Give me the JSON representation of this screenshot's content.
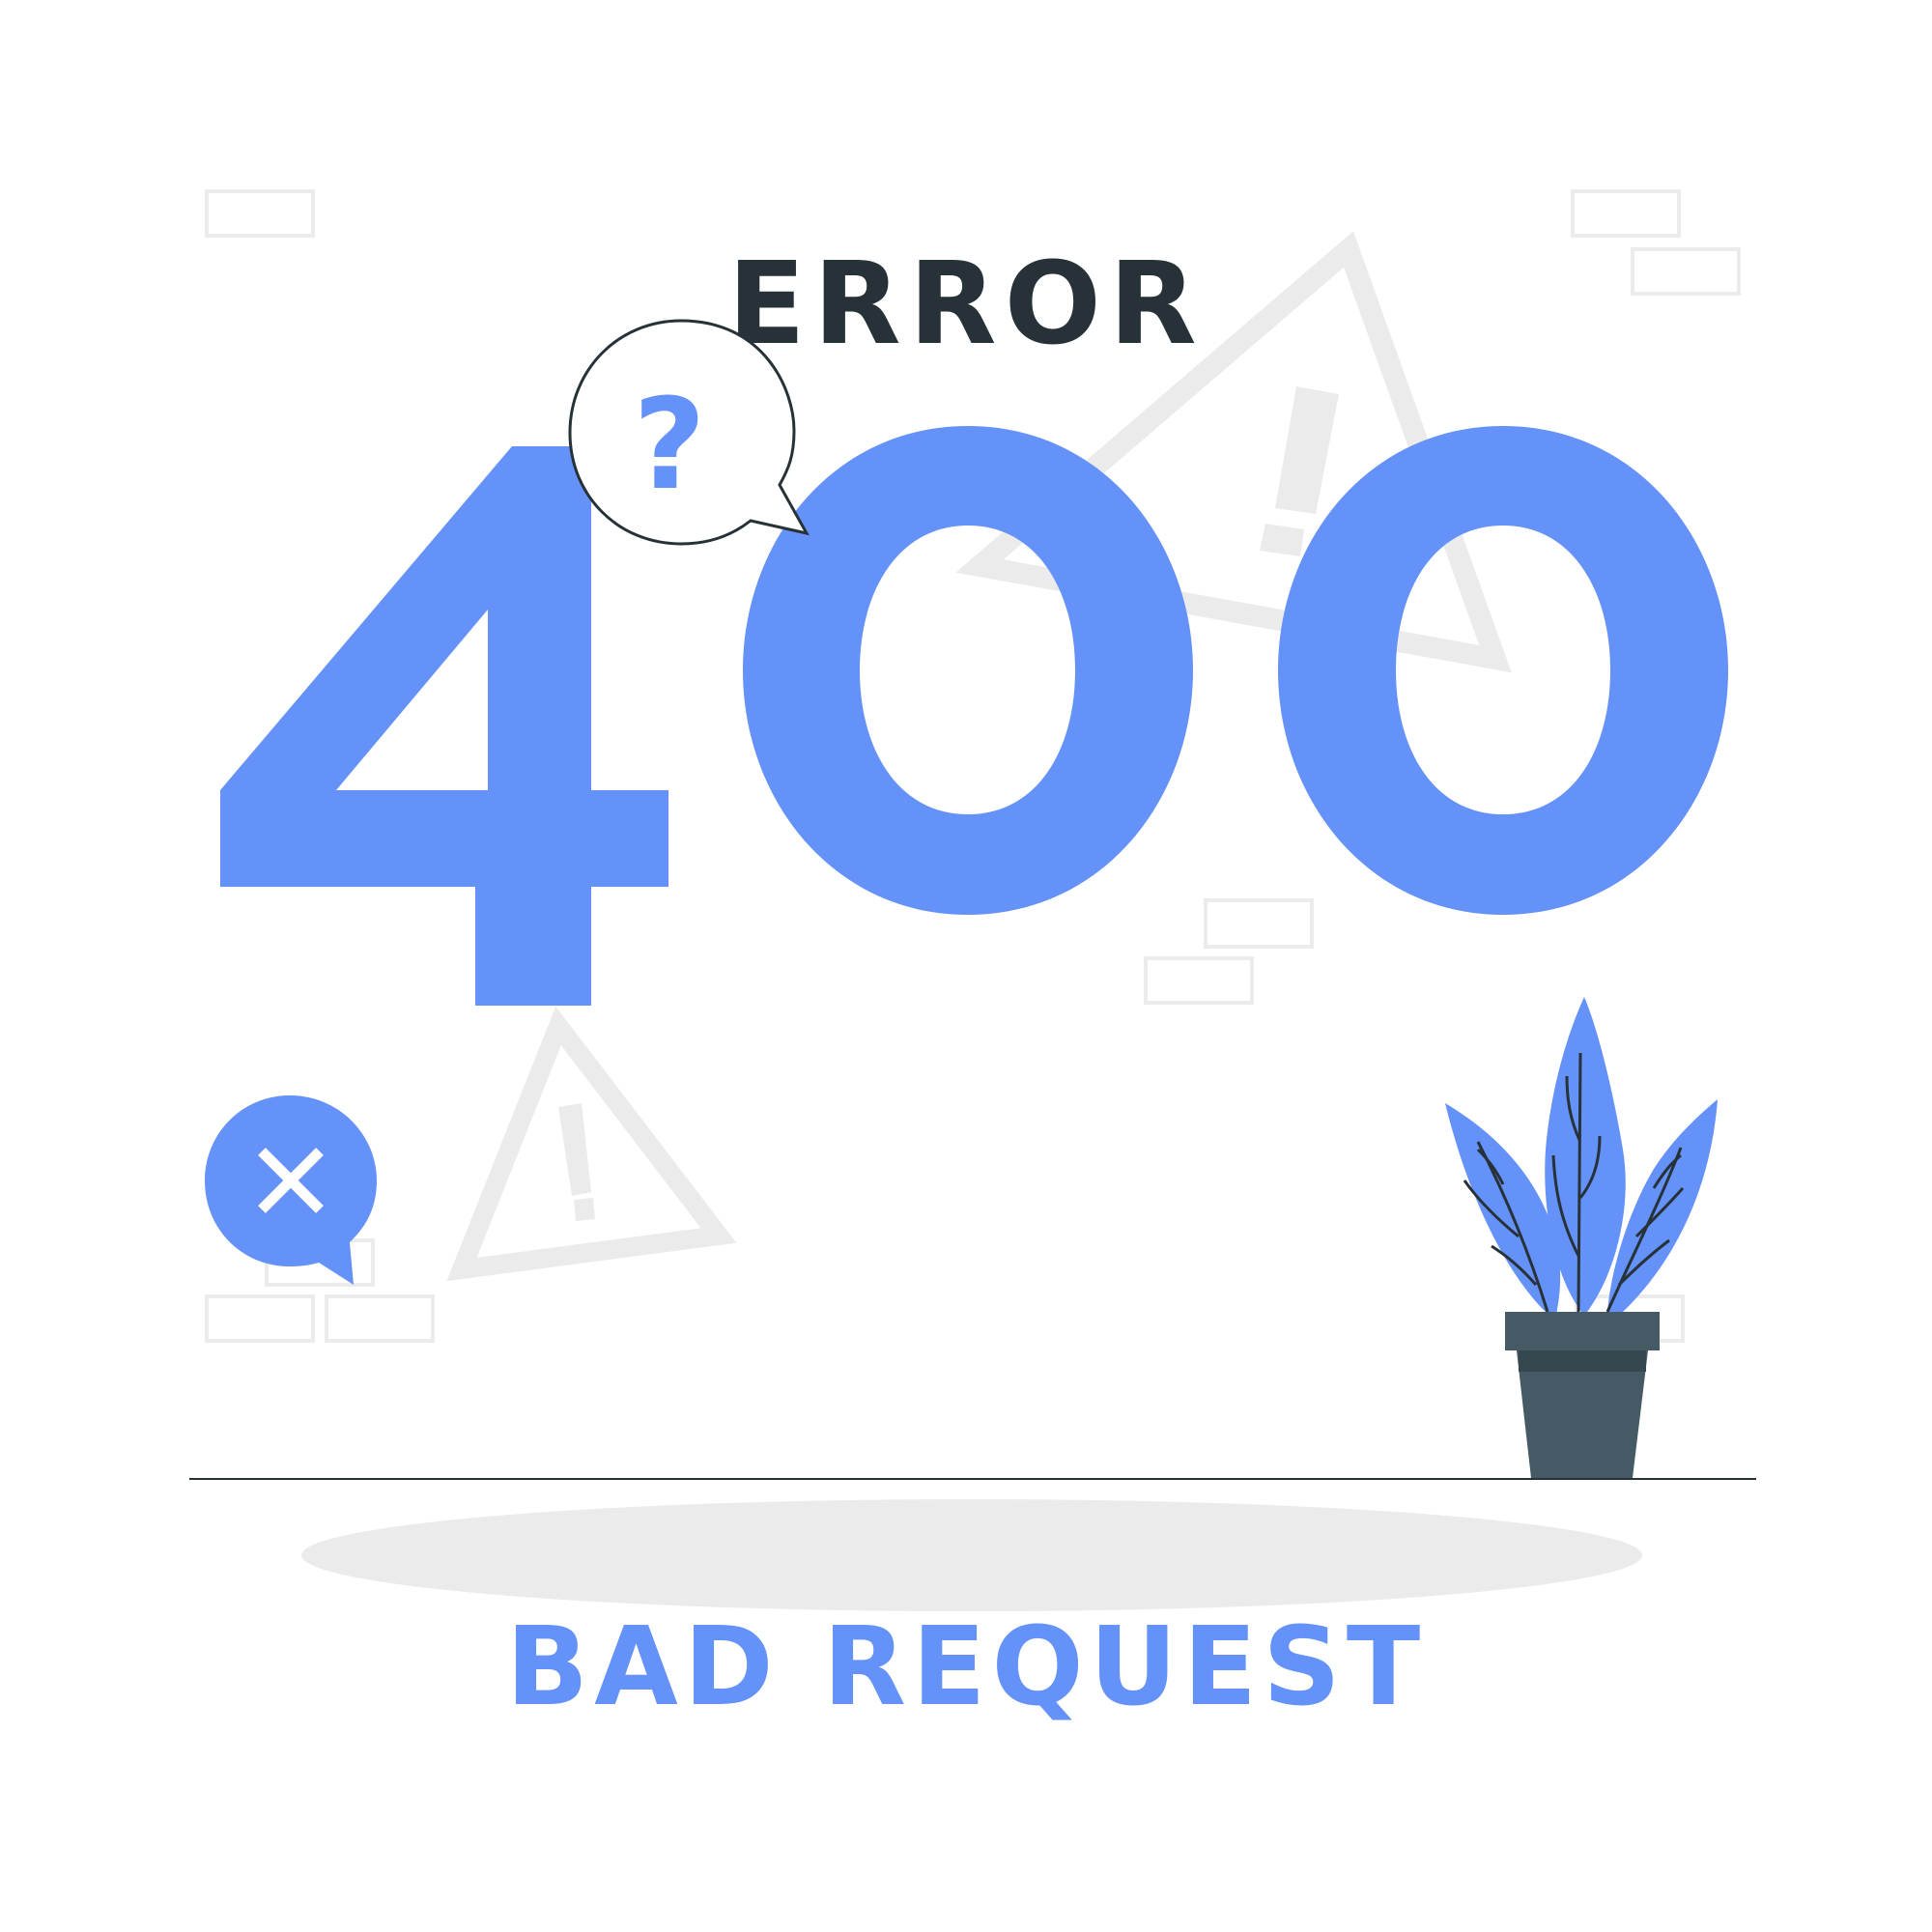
{
  "heading": "ERROR",
  "code": "400",
  "subheading": "BAD REQUEST",
  "bubble_question_glyph": "?",
  "colors": {
    "accent": "#6492F8",
    "dark": "#263238",
    "pot": "#455A64",
    "pot_band": "#37474F",
    "light_gray": "#EBEBEB",
    "white": "#FFFFFF"
  },
  "icons": {
    "question_bubble": "question-bubble-icon",
    "close_bubble": "close-bubble-icon",
    "warning": "warning-triangle-icon",
    "plant": "potted-plant-icon"
  }
}
